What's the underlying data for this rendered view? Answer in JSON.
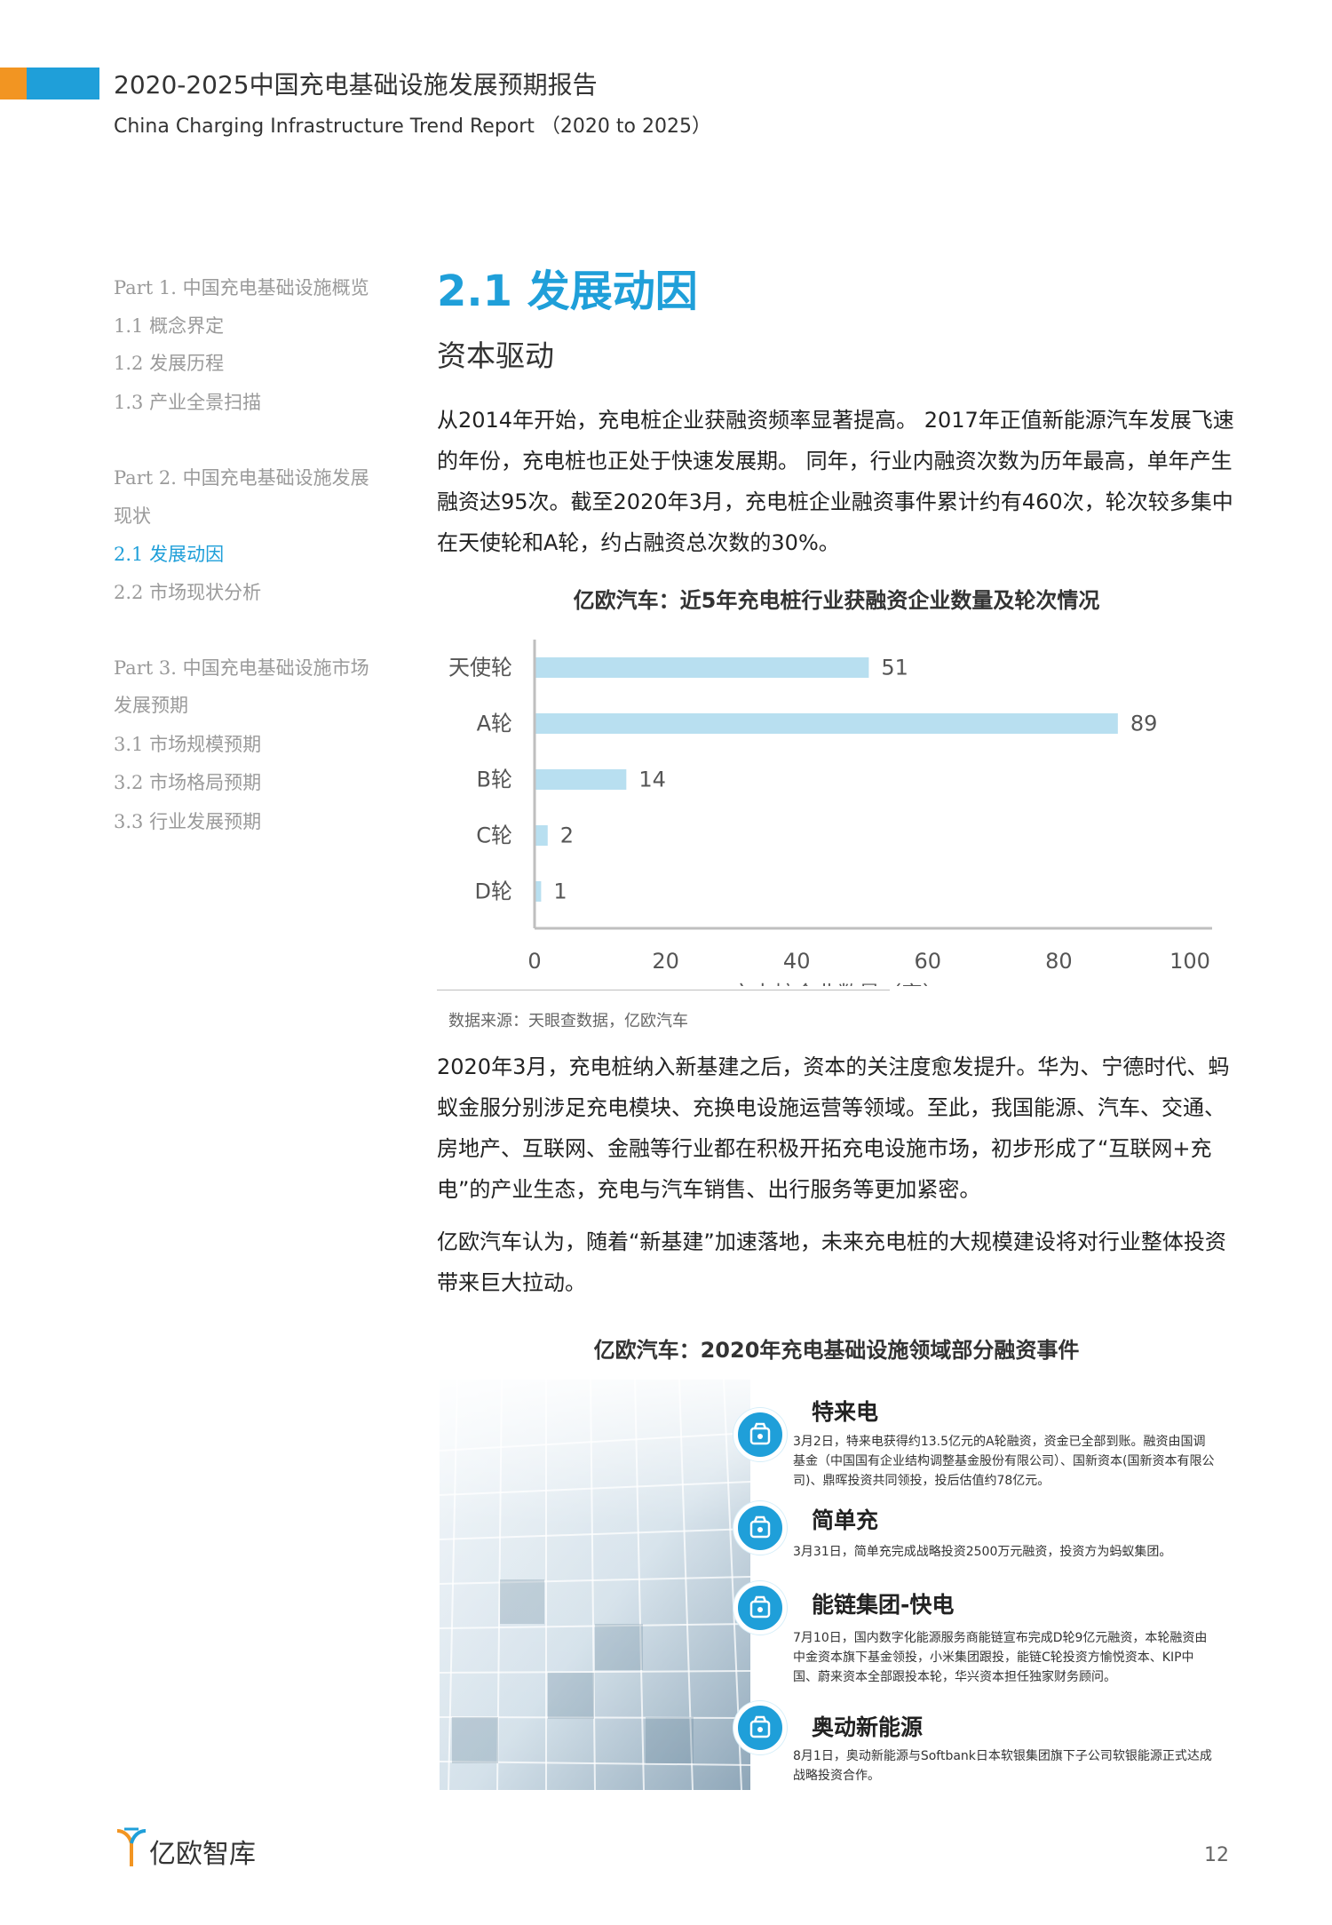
{
  "header": {
    "title": "2020-2025中国充电基础设施发展预期报告",
    "subtitle": "China Charging Infrastructure Trend Report （2020 to 2025）",
    "accent_orange": "#f29522",
    "accent_blue": "#1f9fd9"
  },
  "sidebar": {
    "items": [
      {
        "label": "Part 1. 中国充电基础设施概览",
        "active": false
      },
      {
        "label": "1.1 概念界定",
        "active": false
      },
      {
        "label": "1.2 发展历程",
        "active": false
      },
      {
        "label": "1.3 产业全景扫描",
        "active": false
      },
      {
        "label": "Part 2. 中国充电基础设施发展",
        "active": false
      },
      {
        "label": "现状",
        "active": false
      },
      {
        "label": "2.1 发展动因",
        "active": true
      },
      {
        "label": "2.2 市场现状分析",
        "active": false
      },
      {
        "label": "Part 3. 中国充电基础设施市场",
        "active": false
      },
      {
        "label": "发展预期",
        "active": false
      },
      {
        "label": "3.1 市场规模预期",
        "active": false
      },
      {
        "label": "3.2 市场格局预期",
        "active": false
      },
      {
        "label": "3.3 行业发展预期",
        "active": false
      }
    ]
  },
  "main": {
    "section_title": "2.1 发展动因",
    "section_subtitle": "资本驱动",
    "paragraph1": "从2014年开始，充电桩企业获融资频率显著提高。 2017年正值新能源汽车发展飞速的年份，充电桩也正处于快速发展期。 同年，行业内融资次数为历年最高，单年产生融资达95次。截至2020年3月，充电桩企业融资事件累计约有460次，轮次较多集中在天使轮和A轮，约占融资总次数的30%。",
    "paragraph2": "2020年3月，充电桩纳入新基建之后，资本的关注度愈发提升。华为、宁德时代、蚂蚁金服分别涉足充电模块、充换电设施运营等领域。至此，我国能源、汽车、交通、房地产、互联网、金融等行业都在积极开拓充电设施市场，初步形成了“互联网+充电”的产业生态，充电与汽车销售、出行服务等更加紧密。",
    "paragraph3": "亿欧汽车认为，随着“新基建”加速落地，未来充电桩的大规模建设将对行业整体投资带来巨大拉动。",
    "chart_source": "数据来源：天眼查数据，亿欧汽车"
  },
  "chart_data": {
    "type": "bar",
    "orientation": "horizontal",
    "title": "亿欧汽车：近5年充电桩行业获融资企业数量及轮次情况",
    "categories": [
      "天使轮",
      "A轮",
      "B轮",
      "C轮",
      "D轮"
    ],
    "series": [
      {
        "name": "充电桩企业数量（家）",
        "values": [
          51,
          89,
          14,
          2,
          1
        ]
      }
    ],
    "xlim": [
      0,
      100
    ],
    "xticks": [
      0,
      20,
      40,
      60,
      80,
      100
    ],
    "grid": false,
    "legend": "bottom",
    "bar_color": "#b8dff0"
  },
  "events": {
    "title": "亿欧汽车：2020年充电基础设施领域部分融资事件",
    "items": [
      {
        "name": "特来电",
        "desc": "3月2日，特来电获得约13.5亿元的A轮融资，资金已全部到账。融资由国调基金（中国国有企业结构调整基金股份有限公司）、国新资本(国新资本有限公司)、鼎晖投资共同领投，投后估值约78亿元。",
        "icon": "money-bag-icon"
      },
      {
        "name": "简单充",
        "desc": "3月31日，简单充完成战略投资2500万元融资，投资方为蚂蚁集团。",
        "icon": "money-bag-icon"
      },
      {
        "name": "能链集团-快电",
        "desc": "7月10日，国内数字化能源服务商能链宣布完成D轮9亿元融资，本轮融资由中金资本旗下基金领投，小米集团跟投，能链C轮投资方愉悦资本、KIP中国、蔚来资本全部跟投本轮，华兴资本担任独家财务顾问。",
        "icon": "money-bag-icon"
      },
      {
        "name": "奥动新能源",
        "desc": "8月1日，奥动新能源与Softbank日本软银集团旗下子公司软银能源正式达成战略投资合作。",
        "icon": "money-bag-icon"
      }
    ]
  },
  "footer": {
    "logo_text": "亿欧智库",
    "page_number": "12"
  }
}
